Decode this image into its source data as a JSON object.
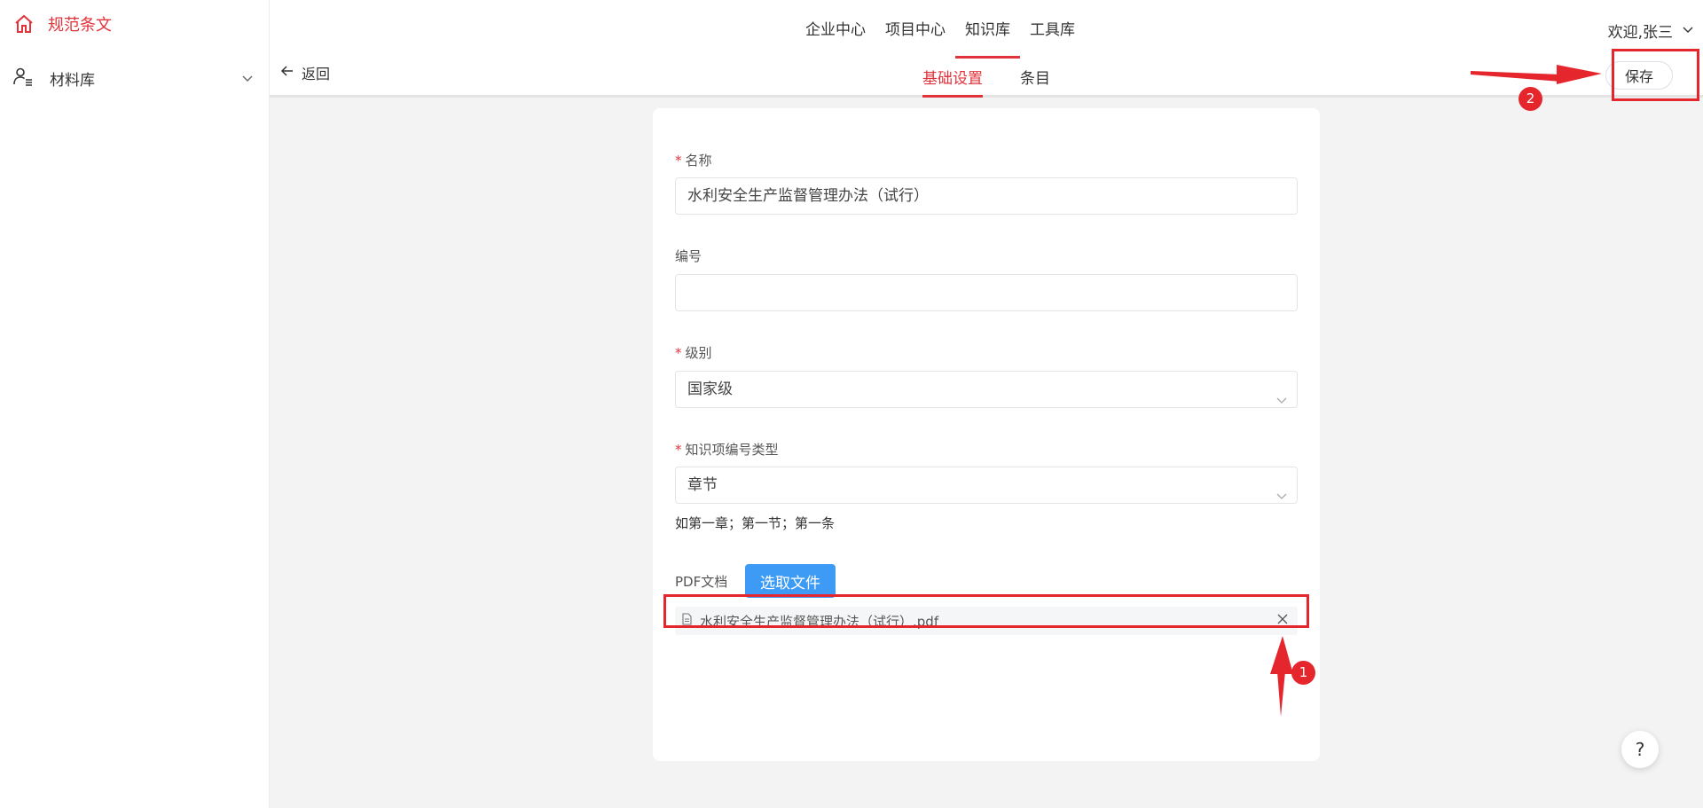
{
  "app": {
    "brand_label": "规范条文",
    "brand_icon": "home-icon",
    "accent_color": "#e0333c"
  },
  "sidebar": {
    "items": [
      {
        "label": "材料库",
        "icon": "user-list-icon",
        "expanded": false
      }
    ]
  },
  "topnav": {
    "items": [
      {
        "label": "企业中心",
        "active": false
      },
      {
        "label": "项目中心",
        "active": false
      },
      {
        "label": "知识库",
        "active": true
      },
      {
        "label": "工具库",
        "active": false
      }
    ],
    "user_greeting": "欢迎,张三"
  },
  "subheader": {
    "back_label": "返回",
    "tabs": [
      {
        "label": "基础设置",
        "active": true
      },
      {
        "label": "条目",
        "active": false
      }
    ],
    "save_label": "保存"
  },
  "form": {
    "name": {
      "label": "名称",
      "required": true,
      "value": "水利安全生产监督管理办法（试行）"
    },
    "code": {
      "label": "编号",
      "required": false,
      "value": ""
    },
    "level": {
      "label": "级别",
      "required": true,
      "value": "国家级"
    },
    "numbering_type": {
      "label": "知识项编号类型",
      "required": true,
      "value": "章节",
      "hint": "如第一章；第一节；第一条"
    },
    "pdf": {
      "label": "PDF文档",
      "upload_label": "选取文件",
      "file_name": "水利安全生产监督管理办法（试行）.pdf"
    }
  },
  "annotations": {
    "badge_1": "1",
    "badge_2": "2",
    "color": "#e5262d"
  },
  "help_label": "?"
}
